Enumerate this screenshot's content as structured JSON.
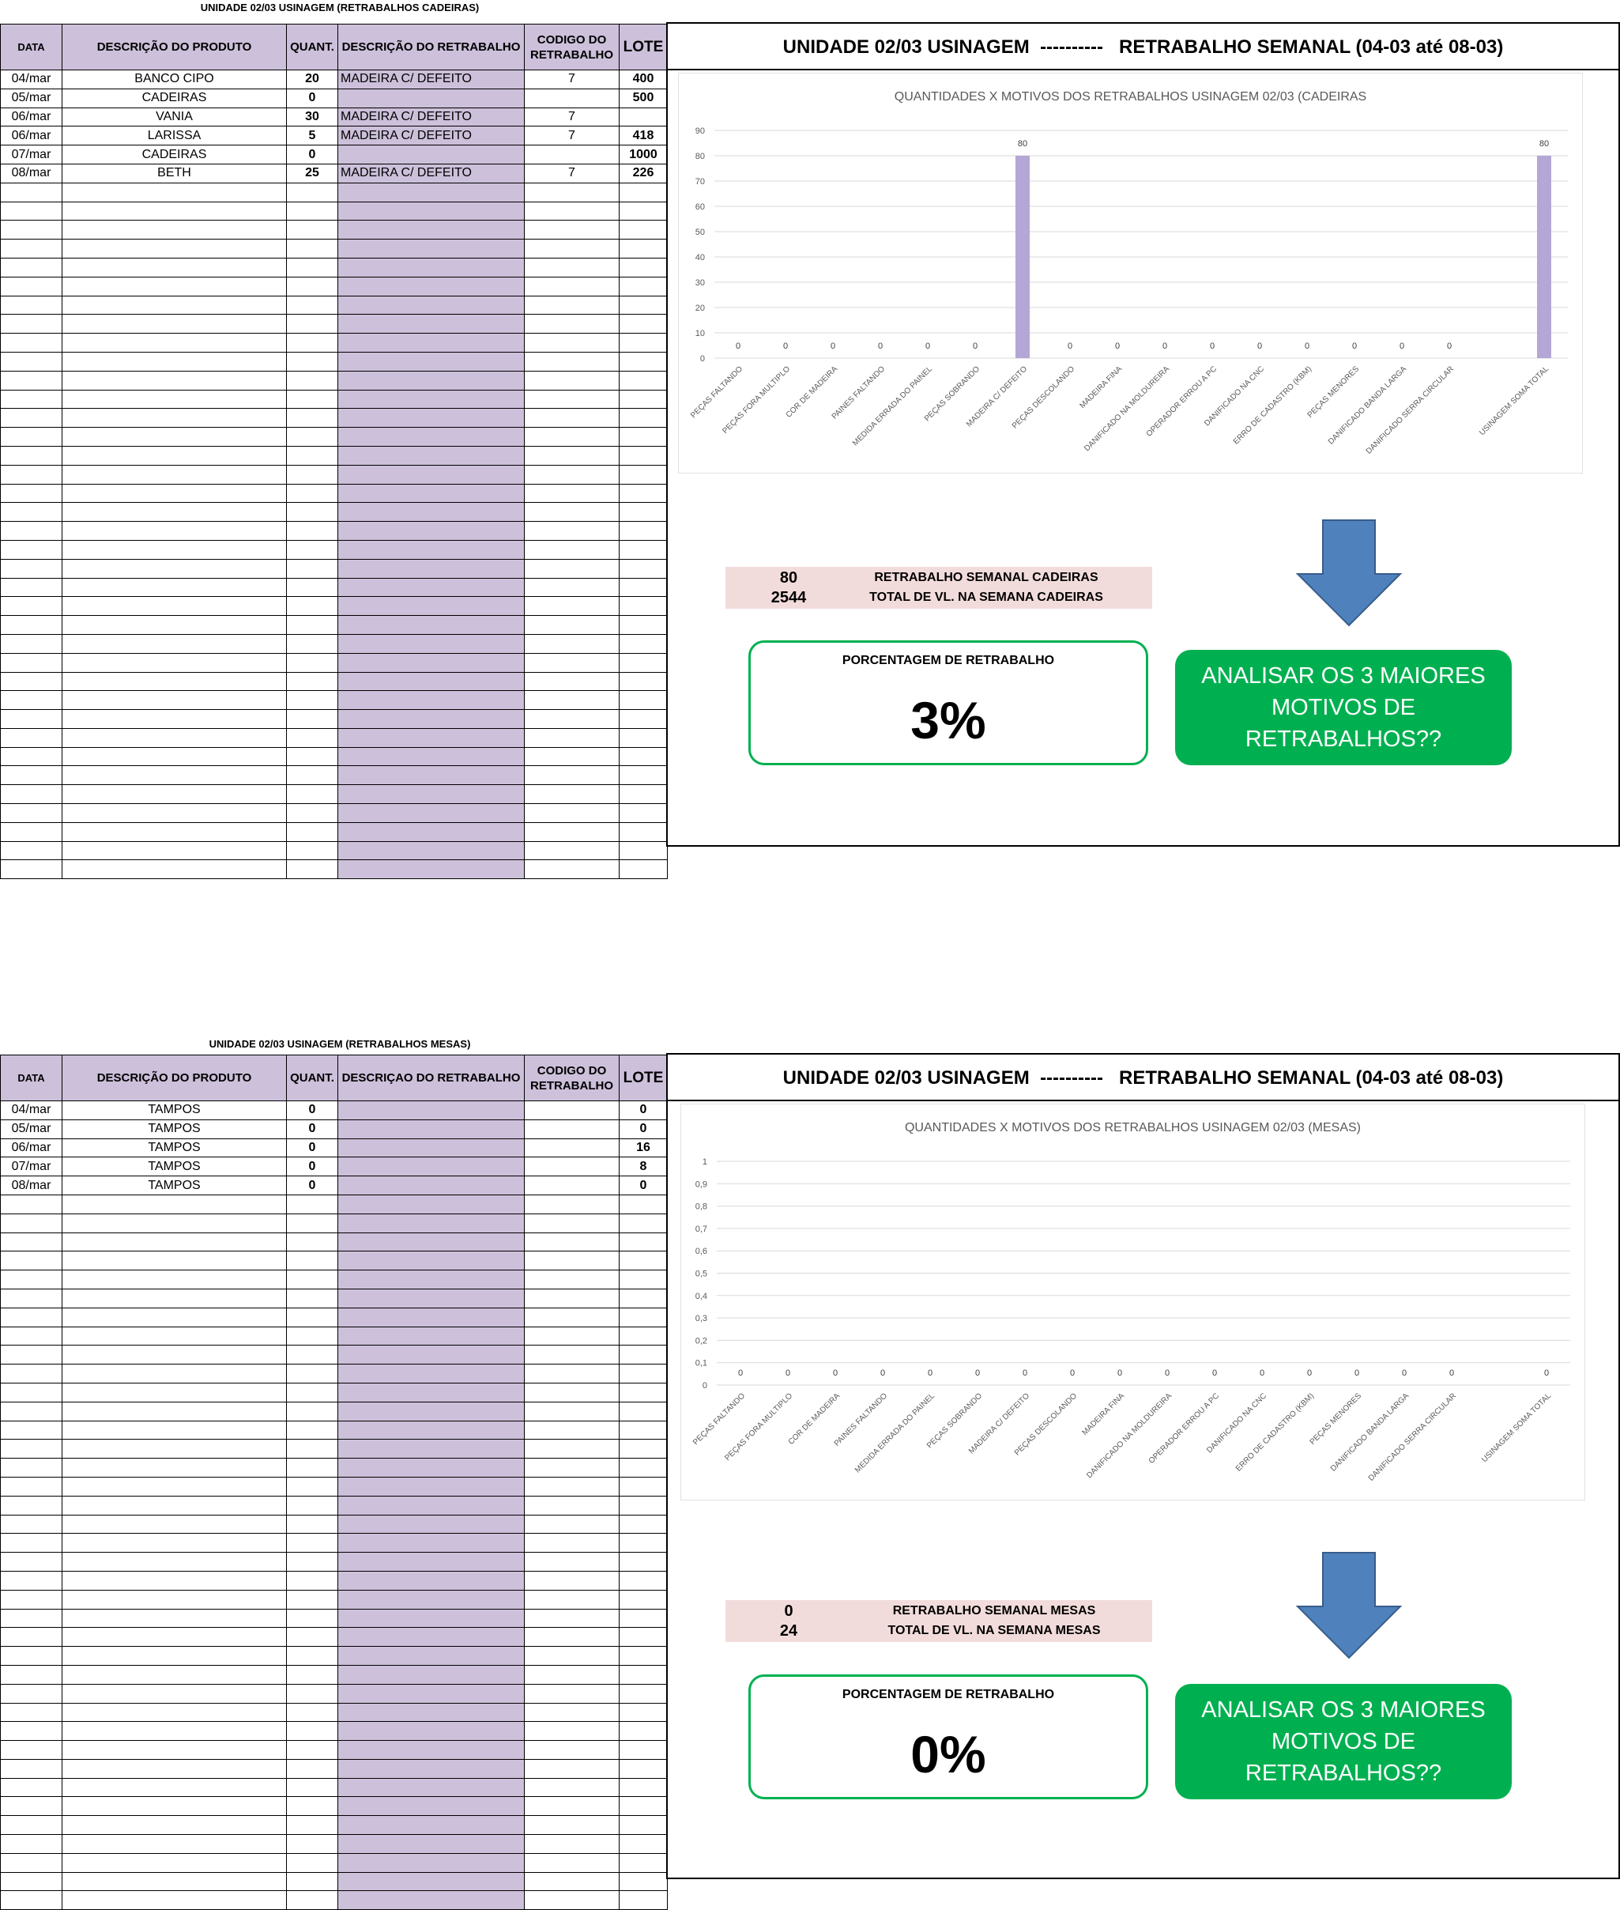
{
  "top": {
    "sheet_title": "UNIDADE 02/03 USINAGEM (RETRABALHOS CADEIRAS)",
    "headers": [
      "DATA",
      "DESCRIÇÃO DO PRODUTO",
      "QUANT.",
      "DESCRIÇÃO DO RETRABALHO",
      "CODIGO DO RETRABALHO",
      "LOTE"
    ],
    "rows": [
      {
        "data": "04/mar",
        "produto": "BANCO CIPO",
        "quant": "20",
        "retrabalho": "MADEIRA C/ DEFEITO",
        "codigo": "7",
        "lote": "400"
      },
      {
        "data": "05/mar",
        "produto": "CADEIRAS",
        "quant": "0",
        "retrabalho": "",
        "codigo": "",
        "lote": "500"
      },
      {
        "data": "06/mar",
        "produto": "VANIA",
        "quant": "30",
        "retrabalho": "MADEIRA C/ DEFEITO",
        "codigo": "7",
        "lote": ""
      },
      {
        "data": "06/mar",
        "produto": "LARISSA",
        "quant": "5",
        "retrabalho": "MADEIRA C/ DEFEITO",
        "codigo": "7",
        "lote": "418"
      },
      {
        "data": "07/mar",
        "produto": "CADEIRAS",
        "quant": "0",
        "retrabalho": "",
        "codigo": "",
        "lote": "1000"
      },
      {
        "data": "08/mar",
        "produto": "BETH",
        "quant": "25",
        "retrabalho": "MADEIRA C/ DEFEITO",
        "codigo": "7",
        "lote": "226"
      }
    ],
    "panel_title": "UNIDADE 02/03 USINAGEM  ----------   RETRABALHO SEMANAL (04-03 até 08-03)",
    "summary": {
      "value1": "80",
      "label1": "RETRABALHO SEMANAL CADEIRAS",
      "value2": "2544",
      "label2": "TOTAL DE VL. NA SEMANA CADEIRAS"
    },
    "pct_label": "PORCENTAGEM DE RETRABALHO",
    "pct_value": "3%",
    "action_label": "ANALISAR OS 3 MAIORES MOTIVOS DE RETRABALHOS??"
  },
  "bottom": {
    "sheet_title": "UNIDADE 02/03 USINAGEM (RETRABALHOS MESAS)",
    "headers": [
      "DATA",
      "DESCRIÇÃO DO PRODUTO",
      "QUANT.",
      "DESCRIÇAO DO RETRABALHO",
      "CODIGO DO RETRABALHO",
      "LOTE"
    ],
    "rows": [
      {
        "data": "04/mar",
        "produto": "TAMPOS",
        "quant": "0",
        "retrabalho": "",
        "codigo": "",
        "lote": "0"
      },
      {
        "data": "05/mar",
        "produto": "TAMPOS",
        "quant": "0",
        "retrabalho": "",
        "codigo": "",
        "lote": "0"
      },
      {
        "data": "06/mar",
        "produto": "TAMPOS",
        "quant": "0",
        "retrabalho": "",
        "codigo": "",
        "lote": "16"
      },
      {
        "data": "07/mar",
        "produto": "TAMPOS",
        "quant": "0",
        "retrabalho": "",
        "codigo": "",
        "lote": "8"
      },
      {
        "data": "08/mar",
        "produto": "TAMPOS",
        "quant": "0",
        "retrabalho": "",
        "codigo": "",
        "lote": "0"
      }
    ],
    "panel_title": "UNIDADE 02/03 USINAGEM  ----------   RETRABALHO SEMANAL (04-03 até 08-03)",
    "summary": {
      "value1": "0",
      "label1": "RETRABALHO SEMANAL MESAS",
      "value2": "24",
      "label2": "TOTAL DE VL. NA SEMANA MESAS"
    },
    "pct_label": "PORCENTAGEM DE RETRABALHO",
    "pct_value": "0%",
    "action_label": "ANALISAR OS 3 MAIORES MOTIVOS DE RETRABALHOS??"
  },
  "colors": {
    "header_fill": "#ccc0da",
    "bar": "#b4a7d6",
    "summary_fill": "#f2dcdb",
    "green": "#00b050",
    "arrow": "#4f81bd",
    "arrow_border": "#385d8a"
  },
  "chart_data": [
    {
      "type": "bar",
      "title": "QUANTIDADES X MOTIVOS DOS RETRABALHOS USINAGEM 02/03 (CADEIRAS",
      "categories": [
        "PEÇAS FALTANDO",
        "PEÇAS FORA MULTIPLO",
        "COR DE MADEIRA",
        "PAINES FALTANDO",
        "MEDIDA ERRADA DO PAINEL",
        "PEÇAS SOBRANDO",
        "MADEIRA C/ DEFEITO",
        "PEÇAS DESCOLANDO",
        "MADEIRA FINA",
        "DANIFICADO NA MOLDUREIRA",
        "OPERADOR ERROU A PC",
        "DANIFICADO NA CNC",
        "ERRO DE CADASTRO (KBM)",
        "PEÇAS MENORES",
        "DANIFICADO BANDA LARGA",
        "DANIFICADO SERRA CIRCULAR",
        "",
        "USINAGEM SOMA TOTAL"
      ],
      "values": [
        0,
        0,
        0,
        0,
        0,
        0,
        80,
        0,
        0,
        0,
        0,
        0,
        0,
        0,
        0,
        0,
        null,
        80
      ],
      "ylim": [
        0,
        90
      ],
      "yticks": [
        "0",
        "10",
        "20",
        "30",
        "40",
        "50",
        "60",
        "70",
        "80",
        "90"
      ],
      "grid": true
    },
    {
      "type": "bar",
      "title": "QUANTIDADES X MOTIVOS DOS RETRABALHOS USINAGEM 02/03 (MESAS)",
      "categories": [
        "PEÇAS FALTANDO",
        "PEÇAS FORA MULTIPLO",
        "COR DE MADEIRA",
        "PAINES FALTANDO",
        "MEDIDA ERRADA DO PAINEL",
        "PEÇAS SOBRANDO",
        "MADEIRA C/ DEFEITO",
        "PEÇAS DESCOLANDO",
        "MADEIRA FINA",
        "DANIFICADO NA MOLDUREIRA",
        "OPERADOR ERROU A PC",
        "DANIFICADO NA CNC",
        "ERRO DE CADASTRO (KBM)",
        "PEÇAS MENORES",
        "DANIFICADO BANDA LARGA",
        "DANIFICADO SERRA CIRCULAR",
        "",
        "USINAGEM SOMA TOTAL"
      ],
      "values": [
        0,
        0,
        0,
        0,
        0,
        0,
        0,
        0,
        0,
        0,
        0,
        0,
        0,
        0,
        0,
        0,
        null,
        0
      ],
      "ylim": [
        0,
        1
      ],
      "yticks": [
        "0",
        "0,1",
        "0,2",
        "0,3",
        "0,4",
        "0,5",
        "0,6",
        "0,7",
        "0,8",
        "0,9",
        "1"
      ],
      "grid": true
    }
  ]
}
